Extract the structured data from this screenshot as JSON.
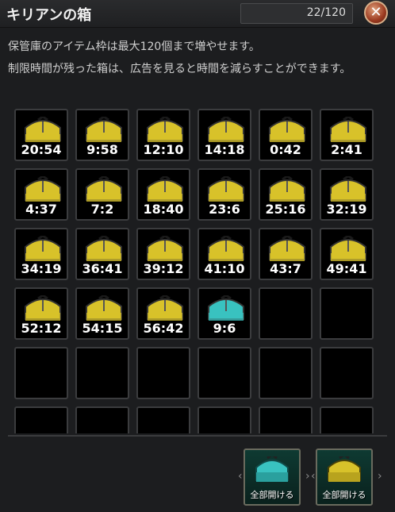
{
  "window": {
    "title": "キリアンの箱",
    "capacity": "22/120",
    "close_symbol": "✕"
  },
  "description": {
    "line1": "保管庫のアイテム枠は最大120個まで増やせます。",
    "line2": "制限時間が残った箱は、広告を見ると時間を減らすことができます。"
  },
  "slots": [
    {
      "timer": "20:54",
      "chest": "yellow"
    },
    {
      "timer": "9:58",
      "chest": "yellow"
    },
    {
      "timer": "12:10",
      "chest": "yellow"
    },
    {
      "timer": "14:18",
      "chest": "yellow"
    },
    {
      "timer": "0:42",
      "chest": "yellow"
    },
    {
      "timer": "2:41",
      "chest": "yellow"
    },
    {
      "timer": "4:37",
      "chest": "yellow"
    },
    {
      "timer": "7:2",
      "chest": "yellow"
    },
    {
      "timer": "18:40",
      "chest": "yellow"
    },
    {
      "timer": "23:6",
      "chest": "yellow"
    },
    {
      "timer": "25:16",
      "chest": "yellow"
    },
    {
      "timer": "32:19",
      "chest": "yellow"
    },
    {
      "timer": "34:19",
      "chest": "yellow"
    },
    {
      "timer": "36:41",
      "chest": "yellow"
    },
    {
      "timer": "39:12",
      "chest": "yellow"
    },
    {
      "timer": "41:10",
      "chest": "yellow"
    },
    {
      "timer": "43:7",
      "chest": "yellow"
    },
    {
      "timer": "49:41",
      "chest": "yellow"
    },
    {
      "timer": "52:12",
      "chest": "yellow"
    },
    {
      "timer": "54:15",
      "chest": "yellow"
    },
    {
      "timer": "56:42",
      "chest": "yellow"
    },
    {
      "timer": "9:6",
      "chest": "teal"
    },
    {
      "timer": "",
      "chest": "none"
    },
    {
      "timer": "",
      "chest": "none"
    },
    {
      "timer": "",
      "chest": "none"
    },
    {
      "timer": "",
      "chest": "none"
    },
    {
      "timer": "",
      "chest": "none"
    },
    {
      "timer": "",
      "chest": "none"
    },
    {
      "timer": "",
      "chest": "none"
    },
    {
      "timer": "",
      "chest": "none"
    },
    {
      "timer": "",
      "chest": "none"
    },
    {
      "timer": "",
      "chest": "none"
    },
    {
      "timer": "",
      "chest": "none"
    },
    {
      "timer": "",
      "chest": "none"
    },
    {
      "timer": "",
      "chest": "none"
    },
    {
      "timer": "",
      "chest": "none"
    }
  ],
  "colors": {
    "chest_yellow": "#d8c22a",
    "chest_teal": "#39c2c0"
  },
  "buttons": {
    "open_all_teal": "全部開ける",
    "open_all_yellow": "全部開ける",
    "arrow_left": "‹",
    "arrow_right": "›"
  }
}
